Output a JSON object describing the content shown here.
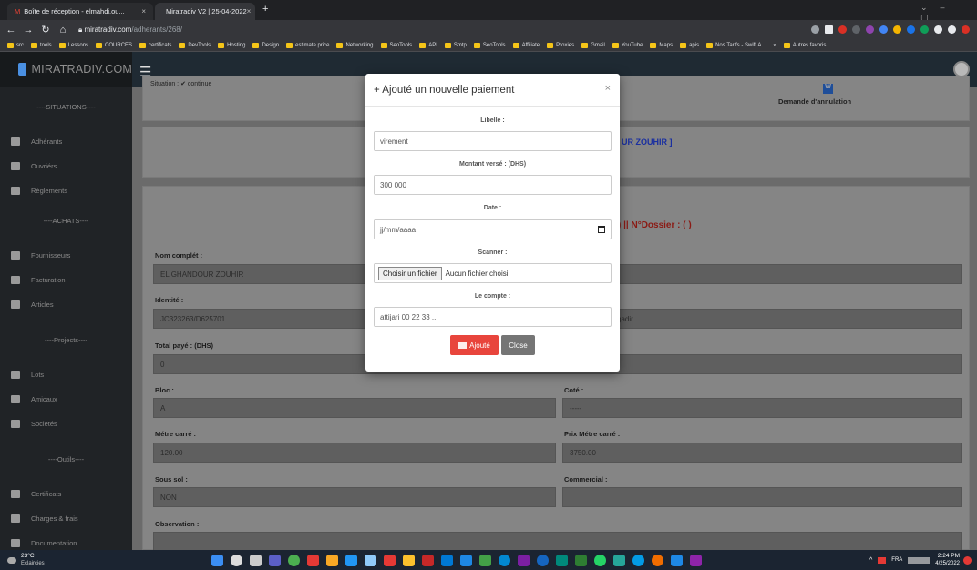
{
  "browser": {
    "tabs": [
      {
        "title": "Boîte de réception - elmahdi.ou...",
        "close": "×"
      },
      {
        "title": "Miratradiv V2 | 25-04-2022",
        "close": "×"
      }
    ],
    "new_tab": "+",
    "url_host": "miratradiv.com",
    "url_path": "/adherants/268/",
    "bookmarks": [
      "src",
      "tools",
      "Lessons",
      "COURCES",
      "certificats",
      "DevTools",
      "Hosting",
      "Design",
      "estimate price",
      "Networking",
      "SeoTools",
      "API",
      "Smtp",
      "SeoTools",
      "Affiliate",
      "Proxies",
      "Gmail",
      "YouTube",
      "Maps",
      "apis",
      "Nos Tarifs - Swift A...",
      "»",
      "Autres favoris"
    ]
  },
  "app": {
    "brand": "MIRATRADIV.COM",
    "sidebar": {
      "sections": [
        {
          "title": "----SITUATIONS----",
          "items": [
            "Adhérants",
            "Ouvriérs",
            "Réglements"
          ]
        },
        {
          "title": "----ACHATS----",
          "items": [
            "Fournisseurs",
            "Facturation",
            "Articles"
          ]
        },
        {
          "title": "----Projects----",
          "items": [
            "Lots",
            "Amicaux",
            "Societés"
          ]
        },
        {
          "title": "----Outils----",
          "items": [
            "Certificats",
            "Charges & frais",
            "Documentation"
          ]
        }
      ]
    },
    "background": {
      "situation": "Situation : ✔ continue",
      "badge": "W",
      "demande": "Demande d'annulation",
      "name_header": "UR ZOUHIR ]",
      "dossier": ") || N°Dossier : ( )",
      "fields": {
        "nom_label": "Nom complét :",
        "nom_value": "EL GHANDOUR ZOUHIR",
        "identite_label": "Identité :",
        "identite_value": "JC323263/D625701",
        "right_value": "ltation timitar agadir",
        "total_label": "Total payé : (DHS)",
        "total_value": "0",
        "bloc_label": "Bloc :",
        "bloc_value": "A",
        "cote_label": "Coté :",
        "cote_value": "-----",
        "metre_label": "Métre carré :",
        "metre_value": "120.00",
        "prix_label": "Prix Métre carré :",
        "prix_value": "3750.00",
        "sous_sol_label": "Sous sol :",
        "sous_sol_value": "NON",
        "commercial_label": "Commercial :",
        "observation_label": "Observation :"
      }
    }
  },
  "modal": {
    "title": "+ Ajouté un nouvelle paiement",
    "close": "×",
    "libelle_label": "Libelle :",
    "libelle_value": "virement",
    "montant_label": "Montant versé : (DHS)",
    "montant_value": "300 000",
    "date_label": "Date :",
    "date_placeholder": "jj/mm/aaaa",
    "scanner_label": "Scanner :",
    "file_button": "Choisir un fichier",
    "file_status": "Aucun fichier choisi",
    "compte_label": "Le compte :",
    "compte_value": "attijari 00 22 33 ..",
    "add_button": "Ajouté",
    "close_button": "Close"
  },
  "taskbar": {
    "weather_temp": "23°C",
    "weather_text": "Eclaircies",
    "lang": "FRA",
    "time": "2:24 PM",
    "date": "4/25/2022"
  },
  "colors": {
    "accent_red": "#e8453c",
    "close_gray": "#757575",
    "header_blue": "#1a2fa0",
    "dossier_red": "#b0201a"
  }
}
